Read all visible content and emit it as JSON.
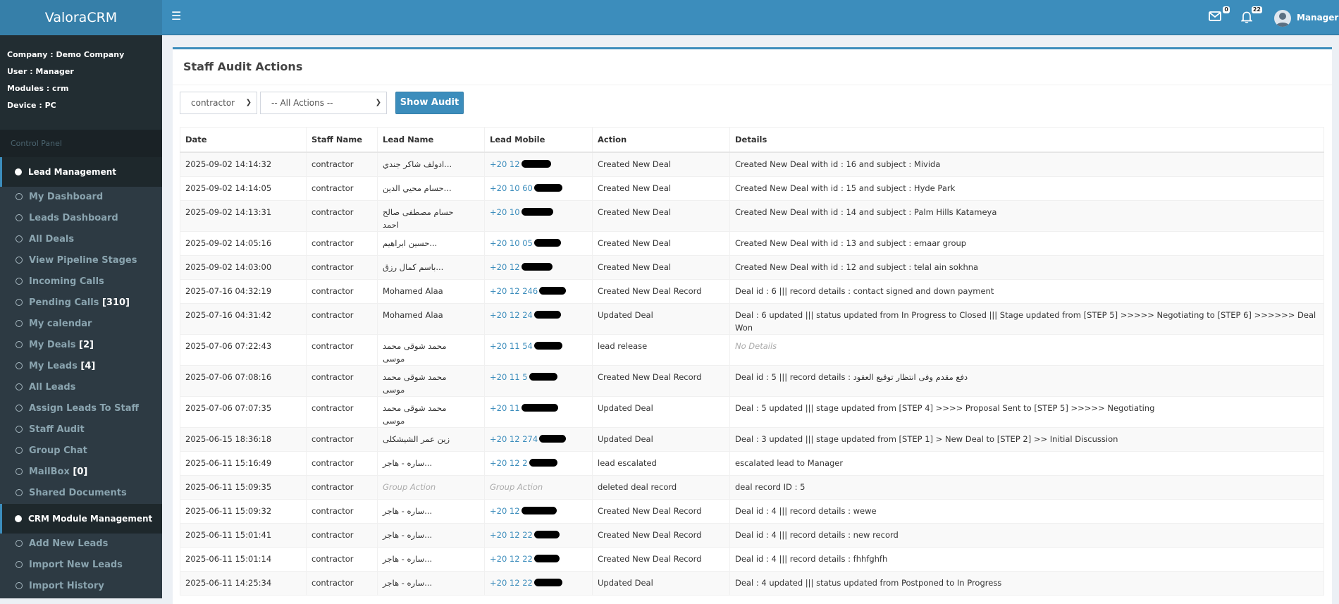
{
  "app": {
    "title": "ValoraCRM"
  },
  "topbar": {
    "mail_badge": "0",
    "notif_badge": "22",
    "user_name": "Manager"
  },
  "sidebar": {
    "info": [
      "Company : Demo Company",
      "User : Manager",
      "Modules : crm",
      "Device : PC"
    ],
    "control_panel": "Control Panel",
    "group1": "Lead Management",
    "items1": [
      {
        "label": "My Dashboard",
        "count": ""
      },
      {
        "label": "Leads Dashboard",
        "count": ""
      },
      {
        "label": "All Deals",
        "count": ""
      },
      {
        "label": "View Pipeline Stages",
        "count": ""
      },
      {
        "label": "Incoming Calls",
        "count": ""
      },
      {
        "label": "Pending Calls",
        "count": "[310]"
      },
      {
        "label": "My calendar",
        "count": ""
      },
      {
        "label": "My Deals",
        "count": "[2]"
      },
      {
        "label": "My Leads",
        "count": "[4]"
      },
      {
        "label": "All Leads",
        "count": ""
      },
      {
        "label": "Assign Leads To Staff",
        "count": ""
      },
      {
        "label": "Staff Audit",
        "count": ""
      },
      {
        "label": "Group Chat",
        "count": ""
      },
      {
        "label": "MailBox",
        "count": "[0]"
      },
      {
        "label": "Shared Documents",
        "count": ""
      }
    ],
    "group2": "CRM Module Management",
    "items2": [
      {
        "label": "Add New Leads",
        "count": ""
      },
      {
        "label": "Import New Leads",
        "count": ""
      },
      {
        "label": "Import History",
        "count": ""
      }
    ]
  },
  "main": {
    "title": "Staff Audit Actions",
    "staff_select": "contractor",
    "action_select": "-- All Actions --",
    "show_button": "Show Audit",
    "columns": [
      "Date",
      "Staff Name",
      "Lead Name",
      "Lead Mobile",
      "Action",
      "Details"
    ],
    "rows": [
      {
        "date": "2025-09-02 14:14:32",
        "staff": "contractor",
        "lead": "...ادولف شاكر جندي",
        "mobile": "+20 12",
        "action": "Created New Deal",
        "details": "Created New Deal with id : 16 and subject : Mivida"
      },
      {
        "date": "2025-09-02 14:14:05",
        "staff": "contractor",
        "lead": "...حسام محيي الدين",
        "mobile": "+20 10 60",
        "action": "Created New Deal",
        "details": "Created New Deal with id : 15 and subject : Hyde Park"
      },
      {
        "date": "2025-09-02 14:13:31",
        "staff": "contractor",
        "lead": "حسام مصطفى صالح احمد",
        "mobile": "+20 10",
        "action": "Created New Deal",
        "details": "Created New Deal with id : 14 and subject : Palm Hills Katameya"
      },
      {
        "date": "2025-09-02 14:05:16",
        "staff": "contractor",
        "lead": "...حسين ابراهيم",
        "mobile": "+20 10 05",
        "action": "Created New Deal",
        "details": "Created New Deal with id : 13 and subject : emaar group"
      },
      {
        "date": "2025-09-02 14:03:00",
        "staff": "contractor",
        "lead": "...باسم كمال رزق",
        "mobile": "+20 12",
        "action": "Created New Deal",
        "details": "Created New Deal with id : 12 and subject : telal ain sokhna"
      },
      {
        "date": "2025-07-16 04:32:19",
        "staff": "contractor",
        "lead": "Mohamed Alaa",
        "mobile": "+20 12 246",
        "action": "Created New Deal Record",
        "details": "Deal id : 6 ||| record details : contact signed and down payment"
      },
      {
        "date": "2025-07-16 04:31:42",
        "staff": "contractor",
        "lead": "Mohamed Alaa",
        "mobile": "+20 12 24",
        "action": "Updated Deal",
        "details": "Deal : 6 updated ||| status updated from In Progress to Closed ||| Stage updated from [STEP 5] >>>>> Negotiating to [STEP 6] >>>>>> Deal Won"
      },
      {
        "date": "2025-07-06 07:22:43",
        "staff": "contractor",
        "lead": "محمد شوقى محمد موسى",
        "mobile": "+20 11 54",
        "action": "lead release",
        "details": "No Details"
      },
      {
        "date": "2025-07-06 07:08:16",
        "staff": "contractor",
        "lead": "محمد شوقى محمد موسى",
        "mobile": "+20 11 5",
        "action": "Created New Deal Record",
        "details": "Deal id : 5 ||| record details : دفع مقدم وفى انتظار توقيع العقود"
      },
      {
        "date": "2025-07-06 07:07:35",
        "staff": "contractor",
        "lead": "محمد شوقى محمد موسى",
        "mobile": "+20 11",
        "action": "Updated Deal",
        "details": "Deal : 5 updated ||| stage updated from [STEP 4] >>>> Proposal Sent to [STEP 5] >>>>> Negotiating"
      },
      {
        "date": "2025-06-15 18:36:18",
        "staff": "contractor",
        "lead": "زين عمر الشيشكلى",
        "mobile": "+20 12 274",
        "action": "Updated Deal",
        "details": "Deal : 3 updated ||| stage updated from [STEP 1] > New Deal to [STEP 2] >> Initial Discussion"
      },
      {
        "date": "2025-06-11 15:16:49",
        "staff": "contractor",
        "lead": "...ساره - هاجر",
        "mobile": "+20 12 2",
        "action": "lead escalated",
        "details": "escalated lead to Manager"
      },
      {
        "date": "2025-06-11 15:09:35",
        "staff": "contractor",
        "lead": "Group Action",
        "mobile": "Group Action",
        "action": "deleted deal record",
        "details": "deal record ID : 5"
      },
      {
        "date": "2025-06-11 15:09:32",
        "staff": "contractor",
        "lead": "...ساره - هاجر",
        "mobile": "+20 12",
        "action": "Created New Deal Record",
        "details": "Deal id : 4 ||| record details : wewe"
      },
      {
        "date": "2025-06-11 15:01:41",
        "staff": "contractor",
        "lead": "...ساره - هاجر",
        "mobile": "+20 12 22",
        "action": "Created New Deal Record",
        "details": "Deal id : 4 ||| record details : new record"
      },
      {
        "date": "2025-06-11 15:01:14",
        "staff": "contractor",
        "lead": "...ساره - هاجر",
        "mobile": "+20 12 22",
        "action": "Created New Deal Record",
        "details": "Deal id : 4 ||| record details : fhhfghfh"
      },
      {
        "date": "2025-06-11 14:25:34",
        "staff": "contractor",
        "lead": "...ساره - هاجر",
        "mobile": "+20 12 22",
        "action": "Updated Deal",
        "details": "Deal : 4 updated ||| status updated from Postponed to In Progress"
      }
    ]
  }
}
